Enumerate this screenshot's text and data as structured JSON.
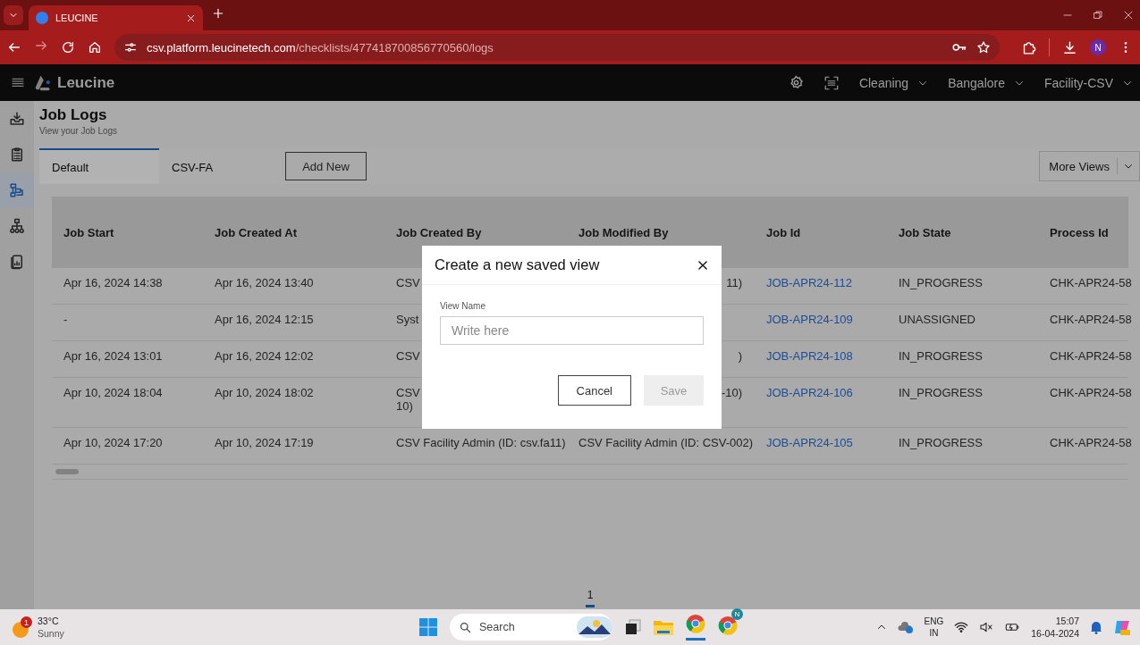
{
  "browser": {
    "tab_title": "LEUCINE",
    "url_host": "csv.platform.leucinetech.com",
    "url_path": "/checklists/477418700856770560/logs",
    "profile_initial": "N"
  },
  "app": {
    "logo": "Leucine",
    "selectors": [
      "Cleaning",
      "Bangalore",
      "Facility-CSV"
    ]
  },
  "sidebar": {
    "items": [
      {
        "kind": "inbox",
        "selected": false
      },
      {
        "kind": "checklist",
        "selected": false
      },
      {
        "kind": "flow",
        "selected": true
      },
      {
        "kind": "hierarchy",
        "selected": false
      },
      {
        "kind": "reports",
        "selected": false
      }
    ]
  },
  "page": {
    "title": "Job Logs",
    "subtitle": "View your Job Logs"
  },
  "view_tabs": [
    {
      "label": "Default",
      "selected": true
    },
    {
      "label": "CSV-FA",
      "selected": false
    }
  ],
  "add_button": "Add New",
  "more_views": "More Views",
  "table": {
    "columns": [
      {
        "label": "Job Start",
        "kind": "text"
      },
      {
        "label": "Job Created At",
        "kind": "text"
      },
      {
        "label": "Job Created By",
        "kind": "text"
      },
      {
        "label": "Job Modified By",
        "kind": "text"
      },
      {
        "label": "Job Id",
        "kind": "link"
      },
      {
        "label": "Job State",
        "kind": "text"
      },
      {
        "label": "Process Id",
        "kind": "text"
      }
    ],
    "rows": [
      {
        "cells": [
          "Apr 16, 2024 14:38",
          "Apr 16, 2024 13:40",
          "CSV",
          {
            "text": "11)",
            "covered": true
          },
          "JOB-APR24-112",
          "IN_PROGRESS",
          "CHK-APR24-58"
        ]
      },
      {
        "cells": [
          "-",
          "Apr 16, 2024 12:15",
          "Syst",
          null,
          "JOB-APR24-109",
          "UNASSIGNED",
          "CHK-APR24-58"
        ]
      },
      {
        "cells": [
          "Apr 16, 2024 13:01",
          "Apr 16, 2024 12:02",
          "CSV",
          {
            "text": ")",
            "covered": true
          },
          "JOB-APR24-108",
          "IN_PROGRESS",
          "CHK-APR24-58"
        ]
      },
      {
        "cells": [
          "Apr 10, 2024 18:04",
          "Apr 10, 2024 18:02",
          "CSV\n10)",
          {
            "text": "-10)",
            "covered": true
          },
          "JOB-APR24-106",
          "IN_PROGRESS",
          "CHK-APR24-58"
        ]
      },
      {
        "cells": [
          "Apr 10, 2024 17:20",
          "Apr 10, 2024 17:19",
          "CSV Facility Admin (ID: csv.fa11)",
          "CSV Facility Admin (ID: CSV-002)",
          "JOB-APR24-105",
          "IN_PROGRESS",
          "CHK-APR24-58"
        ]
      }
    ]
  },
  "pagination": [
    {
      "label": "1",
      "selected": true
    }
  ],
  "dialog": {
    "title": "Create a new saved view",
    "field_label": "View Name",
    "placeholder": "Write here",
    "buttons": [
      {
        "label": "Cancel",
        "disabled": false
      },
      {
        "label": "Save",
        "disabled": true
      }
    ]
  },
  "taskbar": {
    "weather": {
      "temp": "33°C",
      "condition": "Sunny",
      "badge": "1"
    },
    "search_placeholder": "Search",
    "language": [
      "ENG",
      "IN"
    ],
    "time": "15:07",
    "date": "16-04-2024",
    "chrome_badge": "N"
  }
}
